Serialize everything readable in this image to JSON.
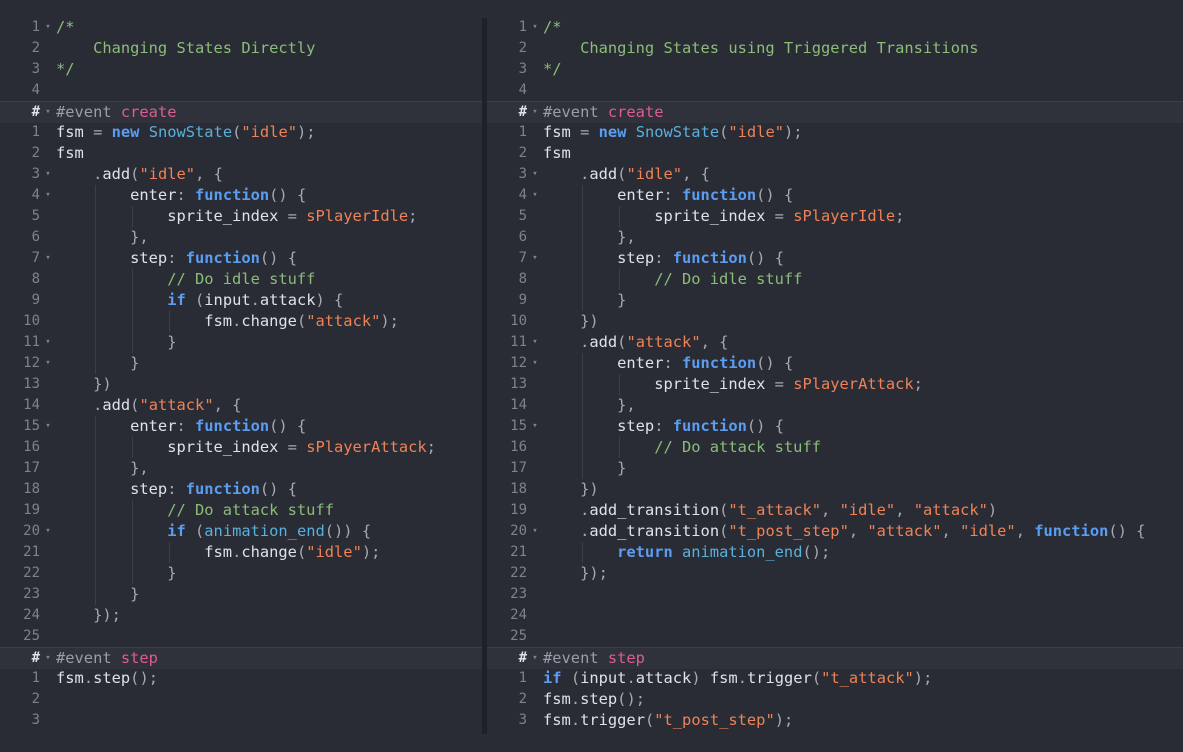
{
  "editor": {
    "left": {
      "lines": [
        {
          "num": "1",
          "fold": true,
          "tokens": [
            [
              "c",
              "/*"
            ]
          ]
        },
        {
          "num": "2",
          "tokens": [
            [
              "c",
              "    Changing States Directly"
            ]
          ]
        },
        {
          "num": "3",
          "tokens": [
            [
              "c",
              "*/"
            ]
          ]
        },
        {
          "num": "4",
          "tokens": []
        },
        {
          "num": "#",
          "fold": true,
          "sep": true,
          "tokens": [
            [
              "h",
              "#event "
            ],
            [
              "e",
              "create"
            ]
          ]
        },
        {
          "num": "1",
          "tokens": [
            [
              "i",
              "fsm "
            ],
            [
              "o",
              "= "
            ],
            [
              "k",
              "new "
            ],
            [
              "t",
              "SnowState"
            ],
            [
              "o",
              "("
            ],
            [
              "s",
              "\"idle\""
            ],
            [
              "o",
              ");"
            ]
          ]
        },
        {
          "num": "2",
          "tokens": [
            [
              "i",
              "fsm"
            ]
          ]
        },
        {
          "num": "3",
          "fold": true,
          "tokens": [
            [
              "i",
              "    "
            ],
            [
              "o",
              "."
            ],
            [
              "i",
              "add"
            ],
            [
              "o",
              "("
            ],
            [
              "s",
              "\"idle\""
            ],
            [
              "o",
              ", {"
            ]
          ]
        },
        {
          "num": "4",
          "fold": true,
          "tokens": [
            [
              "i",
              "        enter"
            ],
            [
              "o",
              ": "
            ],
            [
              "k",
              "function"
            ],
            [
              "o",
              "() {"
            ]
          ]
        },
        {
          "num": "5",
          "tokens": [
            [
              "i",
              "            sprite_index "
            ],
            [
              "o",
              "= "
            ],
            [
              "r",
              "sPlayerIdle"
            ],
            [
              "o",
              ";"
            ]
          ]
        },
        {
          "num": "6",
          "tokens": [
            [
              "o",
              "        },"
            ]
          ]
        },
        {
          "num": "7",
          "fold": true,
          "tokens": [
            [
              "i",
              "        step"
            ],
            [
              "o",
              ": "
            ],
            [
              "k",
              "function"
            ],
            [
              "o",
              "() {"
            ]
          ]
        },
        {
          "num": "8",
          "tokens": [
            [
              "c",
              "            // Do idle stuff"
            ]
          ]
        },
        {
          "num": "9",
          "tokens": [
            [
              "k",
              "            if "
            ],
            [
              "o",
              "("
            ],
            [
              "i",
              "input"
            ],
            [
              "o",
              "."
            ],
            [
              "i",
              "attack"
            ],
            [
              "o",
              ") {"
            ]
          ]
        },
        {
          "num": "10",
          "tokens": [
            [
              "i",
              "                fsm"
            ],
            [
              "o",
              "."
            ],
            [
              "i",
              "change"
            ],
            [
              "o",
              "("
            ],
            [
              "s",
              "\"attack\""
            ],
            [
              "o",
              ");"
            ]
          ]
        },
        {
          "num": "11",
          "fold": true,
          "tokens": [
            [
              "o",
              "            }"
            ]
          ]
        },
        {
          "num": "12",
          "fold": true,
          "tokens": [
            [
              "o",
              "        }"
            ]
          ]
        },
        {
          "num": "13",
          "tokens": [
            [
              "o",
              "    })"
            ]
          ]
        },
        {
          "num": "14",
          "tokens": [
            [
              "i",
              "    "
            ],
            [
              "o",
              "."
            ],
            [
              "i",
              "add"
            ],
            [
              "o",
              "("
            ],
            [
              "s",
              "\"attack\""
            ],
            [
              "o",
              ", {"
            ]
          ]
        },
        {
          "num": "15",
          "fold": true,
          "tokens": [
            [
              "i",
              "        enter"
            ],
            [
              "o",
              ": "
            ],
            [
              "k",
              "function"
            ],
            [
              "o",
              "() {"
            ]
          ]
        },
        {
          "num": "16",
          "tokens": [
            [
              "i",
              "            sprite_index "
            ],
            [
              "o",
              "= "
            ],
            [
              "r",
              "sPlayerAttack"
            ],
            [
              "o",
              ";"
            ]
          ]
        },
        {
          "num": "17",
          "tokens": [
            [
              "o",
              "        },"
            ]
          ]
        },
        {
          "num": "18",
          "tokens": [
            [
              "i",
              "        step"
            ],
            [
              "o",
              ": "
            ],
            [
              "k",
              "function"
            ],
            [
              "o",
              "() {"
            ]
          ]
        },
        {
          "num": "19",
          "tokens": [
            [
              "c",
              "            // Do attack stuff"
            ]
          ]
        },
        {
          "num": "20",
          "fold": true,
          "tokens": [
            [
              "k",
              "            if "
            ],
            [
              "o",
              "("
            ],
            [
              "f",
              "animation_end"
            ],
            [
              "o",
              "()) {"
            ]
          ]
        },
        {
          "num": "21",
          "tokens": [
            [
              "i",
              "                fsm"
            ],
            [
              "o",
              "."
            ],
            [
              "i",
              "change"
            ],
            [
              "o",
              "("
            ],
            [
              "s",
              "\"idle\""
            ],
            [
              "o",
              ");"
            ]
          ]
        },
        {
          "num": "22",
          "tokens": [
            [
              "o",
              "            }"
            ]
          ]
        },
        {
          "num": "23",
          "tokens": [
            [
              "o",
              "        }"
            ]
          ]
        },
        {
          "num": "24",
          "tokens": [
            [
              "o",
              "    });"
            ]
          ]
        },
        {
          "num": "25",
          "tokens": []
        },
        {
          "num": "#",
          "fold": true,
          "sep": true,
          "tokens": [
            [
              "h",
              "#event "
            ],
            [
              "e",
              "step"
            ]
          ]
        },
        {
          "num": "1",
          "tokens": [
            [
              "i",
              "fsm"
            ],
            [
              "o",
              "."
            ],
            [
              "i",
              "step"
            ],
            [
              "o",
              "();"
            ]
          ]
        },
        {
          "num": "2",
          "tokens": []
        },
        {
          "num": "3",
          "tokens": []
        }
      ]
    },
    "right": {
      "lines": [
        {
          "num": "1",
          "fold": true,
          "tokens": [
            [
              "c",
              "/*"
            ]
          ]
        },
        {
          "num": "2",
          "tokens": [
            [
              "c",
              "    Changing States using Triggered Transitions"
            ]
          ]
        },
        {
          "num": "3",
          "tokens": [
            [
              "c",
              "*/"
            ]
          ]
        },
        {
          "num": "4",
          "tokens": []
        },
        {
          "num": "#",
          "fold": true,
          "sep": true,
          "tokens": [
            [
              "h",
              "#event "
            ],
            [
              "e",
              "create"
            ]
          ]
        },
        {
          "num": "1",
          "tokens": [
            [
              "i",
              "fsm "
            ],
            [
              "o",
              "= "
            ],
            [
              "k",
              "new "
            ],
            [
              "t",
              "SnowState"
            ],
            [
              "o",
              "("
            ],
            [
              "s",
              "\"idle\""
            ],
            [
              "o",
              ");"
            ]
          ]
        },
        {
          "num": "2",
          "tokens": [
            [
              "i",
              "fsm"
            ]
          ]
        },
        {
          "num": "3",
          "fold": true,
          "tokens": [
            [
              "i",
              "    "
            ],
            [
              "o",
              "."
            ],
            [
              "i",
              "add"
            ],
            [
              "o",
              "("
            ],
            [
              "s",
              "\"idle\""
            ],
            [
              "o",
              ", {"
            ]
          ]
        },
        {
          "num": "4",
          "fold": true,
          "tokens": [
            [
              "i",
              "        enter"
            ],
            [
              "o",
              ": "
            ],
            [
              "k",
              "function"
            ],
            [
              "o",
              "() {"
            ]
          ]
        },
        {
          "num": "5",
          "tokens": [
            [
              "i",
              "            sprite_index "
            ],
            [
              "o",
              "= "
            ],
            [
              "r",
              "sPlayerIdle"
            ],
            [
              "o",
              ";"
            ]
          ]
        },
        {
          "num": "6",
          "tokens": [
            [
              "o",
              "        },"
            ]
          ]
        },
        {
          "num": "7",
          "fold": true,
          "tokens": [
            [
              "i",
              "        step"
            ],
            [
              "o",
              ": "
            ],
            [
              "k",
              "function"
            ],
            [
              "o",
              "() {"
            ]
          ]
        },
        {
          "num": "8",
          "tokens": [
            [
              "c",
              "            // Do idle stuff"
            ]
          ]
        },
        {
          "num": "9",
          "tokens": [
            [
              "o",
              "        }"
            ]
          ]
        },
        {
          "num": "10",
          "tokens": [
            [
              "o",
              "    })"
            ]
          ]
        },
        {
          "num": "11",
          "fold": true,
          "tokens": [
            [
              "i",
              "    "
            ],
            [
              "o",
              "."
            ],
            [
              "i",
              "add"
            ],
            [
              "o",
              "("
            ],
            [
              "s",
              "\"attack\""
            ],
            [
              "o",
              ", {"
            ]
          ]
        },
        {
          "num": "12",
          "fold": true,
          "tokens": [
            [
              "i",
              "        enter"
            ],
            [
              "o",
              ": "
            ],
            [
              "k",
              "function"
            ],
            [
              "o",
              "() {"
            ]
          ]
        },
        {
          "num": "13",
          "tokens": [
            [
              "i",
              "            sprite_index "
            ],
            [
              "o",
              "= "
            ],
            [
              "r",
              "sPlayerAttack"
            ],
            [
              "o",
              ";"
            ]
          ]
        },
        {
          "num": "14",
          "tokens": [
            [
              "o",
              "        },"
            ]
          ]
        },
        {
          "num": "15",
          "fold": true,
          "tokens": [
            [
              "i",
              "        step"
            ],
            [
              "o",
              ": "
            ],
            [
              "k",
              "function"
            ],
            [
              "o",
              "() {"
            ]
          ]
        },
        {
          "num": "16",
          "tokens": [
            [
              "c",
              "            // Do attack stuff"
            ]
          ]
        },
        {
          "num": "17",
          "tokens": [
            [
              "o",
              "        }"
            ]
          ]
        },
        {
          "num": "18",
          "tokens": [
            [
              "o",
              "    })"
            ]
          ]
        },
        {
          "num": "19",
          "tokens": [
            [
              "i",
              "    "
            ],
            [
              "o",
              "."
            ],
            [
              "i",
              "add_transition"
            ],
            [
              "o",
              "("
            ],
            [
              "s",
              "\"t_attack\""
            ],
            [
              "o",
              ", "
            ],
            [
              "s",
              "\"idle\""
            ],
            [
              "o",
              ", "
            ],
            [
              "s",
              "\"attack\""
            ],
            [
              "o",
              ")"
            ]
          ]
        },
        {
          "num": "20",
          "fold": true,
          "tokens": [
            [
              "i",
              "    "
            ],
            [
              "o",
              "."
            ],
            [
              "i",
              "add_transition"
            ],
            [
              "o",
              "("
            ],
            [
              "s",
              "\"t_post_step\""
            ],
            [
              "o",
              ", "
            ],
            [
              "s",
              "\"attack\""
            ],
            [
              "o",
              ", "
            ],
            [
              "s",
              "\"idle\""
            ],
            [
              "o",
              ", "
            ],
            [
              "k",
              "function"
            ],
            [
              "o",
              "() {"
            ]
          ]
        },
        {
          "num": "21",
          "tokens": [
            [
              "k",
              "        return "
            ],
            [
              "f",
              "animation_end"
            ],
            [
              "o",
              "();"
            ]
          ]
        },
        {
          "num": "22",
          "tokens": [
            [
              "o",
              "    });"
            ]
          ]
        },
        {
          "num": "23",
          "tokens": []
        },
        {
          "num": "24",
          "tokens": []
        },
        {
          "num": "25",
          "tokens": []
        },
        {
          "num": "#",
          "fold": true,
          "sep": true,
          "tokens": [
            [
              "h",
              "#event "
            ],
            [
              "e",
              "step"
            ]
          ]
        },
        {
          "num": "1",
          "tokens": [
            [
              "k",
              "if "
            ],
            [
              "o",
              "("
            ],
            [
              "i",
              "input"
            ],
            [
              "o",
              "."
            ],
            [
              "i",
              "attack"
            ],
            [
              "o",
              ") "
            ],
            [
              "i",
              "fsm"
            ],
            [
              "o",
              "."
            ],
            [
              "i",
              "trigger"
            ],
            [
              "o",
              "("
            ],
            [
              "s",
              "\"t_attack\""
            ],
            [
              "o",
              ");"
            ]
          ]
        },
        {
          "num": "2",
          "tokens": [
            [
              "i",
              "fsm"
            ],
            [
              "o",
              "."
            ],
            [
              "i",
              "step"
            ],
            [
              "o",
              "();"
            ]
          ]
        },
        {
          "num": "3",
          "tokens": [
            [
              "i",
              "fsm"
            ],
            [
              "o",
              "."
            ],
            [
              "i",
              "trigger"
            ],
            [
              "o",
              "("
            ],
            [
              "s",
              "\"t_post_step\""
            ],
            [
              "o",
              ");"
            ]
          ]
        }
      ]
    }
  },
  "colors": {
    "background": "#292c35",
    "comment": "#8cbd78",
    "event_name": "#dd5c94",
    "keyword": "#5b9df0",
    "string": "#ef8256",
    "resource": "#ef8256",
    "function": "#5ab0dc",
    "text": "#dfe2e8",
    "line_number": "#7d828d"
  }
}
